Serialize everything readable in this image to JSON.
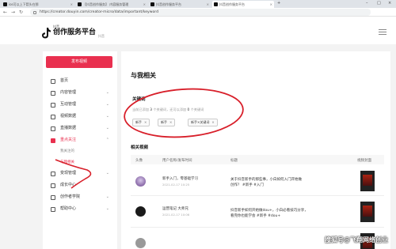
{
  "browser": {
    "tabs": [
      {
        "label": "ios可以上下箭头在那"
      },
      {
        "label": "【抖音创作服务】 内容服务管理"
      },
      {
        "label": "抖音创作服务平台"
      },
      {
        "label": "抖音创作服务平台"
      }
    ],
    "url": "https://creator.douyin.com/creator-micro/data/important/keyword"
  },
  "header": {
    "brand_small": "抖音",
    "brand_title": "创作服务平台",
    "brand_sub": "抖音"
  },
  "sidebar": {
    "publish_button": "发布视频",
    "items": [
      {
        "label": "首页",
        "icon": "home-icon",
        "chevron": ""
      },
      {
        "label": "内容管理",
        "icon": "content-icon",
        "chevron": "⌄"
      },
      {
        "label": "互动管理",
        "icon": "interaction-icon",
        "chevron": "⌄"
      },
      {
        "label": "视频数据",
        "icon": "chart-icon",
        "chevron": "⌄"
      },
      {
        "label": "直播数据",
        "icon": "live-icon",
        "chevron": "⌄"
      },
      {
        "label": "重点关注",
        "icon": "focus-icon",
        "chevron": "⌃"
      },
      {
        "label": "我关注的",
        "icon": "",
        "chevron": ""
      },
      {
        "label": "与我相关",
        "icon": "",
        "chevron": ""
      },
      {
        "label": "变现管理",
        "icon": "money-icon",
        "chevron": "⌄"
      },
      {
        "label": "成长中心",
        "icon": "growth-icon",
        "chevron": ""
      },
      {
        "label": "创作者学院",
        "icon": "academy-icon",
        "chevron": "⌄"
      },
      {
        "label": "帮助中心",
        "icon": "help-icon",
        "chevron": "⌄"
      }
    ]
  },
  "main": {
    "page_title": "与我相关",
    "keywords_title": "关键词",
    "keywords_hint_prefix": "当前已添加",
    "keywords_count": "3",
    "keywords_hint_mid": "个关键词，还可以添加",
    "keywords_remaining": "0",
    "keywords_hint_suffix": "个关键词",
    "chips": [
      "新手",
      "新手",
      "新手×关键词"
    ],
    "chip_close": "×",
    "related_title": "相关视频",
    "columns": [
      "头像",
      "用户名称/发布时间",
      "标题",
      "视频封面"
    ],
    "rows": [
      {
        "name": "新手入门，零基础学习",
        "date": "2021-02-17 10:25",
        "title_line1": "关于抖音新手的那些事，小白如何入门开始做",
        "title_line2": "创作？ #新手 #入门"
      },
      {
        "name": "运营笔记 大师兄",
        "date": "2021-02-17 10:06",
        "title_line1": "抖音新手如何开始做dou+，小白必看技巧分享，",
        "title_line2": "看完你也能学会 #新手 #dou+"
      },
      {
        "name": "",
        "date": "",
        "title_line1": "",
        "title_line2": ""
      }
    ]
  },
  "watermark": "搜狐号@飞翔网络创业"
}
